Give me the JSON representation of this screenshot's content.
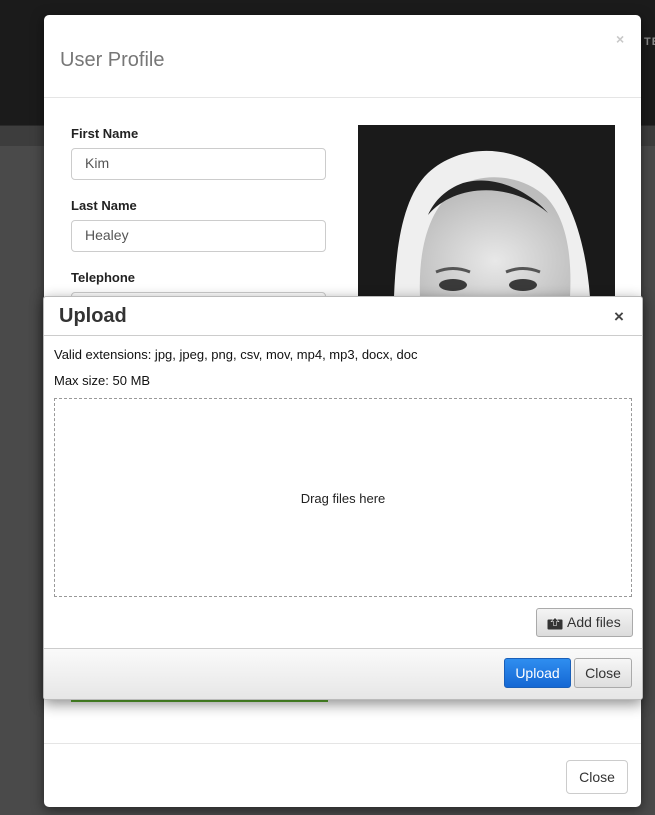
{
  "background": {
    "peek_text": "TE"
  },
  "profile": {
    "title": "User Profile",
    "close_icon": "×",
    "fields": {
      "first_name": {
        "label": "First Name",
        "value": "Kim"
      },
      "last_name": {
        "label": "Last Name",
        "value": "Healey"
      },
      "telephone": {
        "label": "Telephone",
        "value": ""
      }
    },
    "footer_close_label": "Close"
  },
  "upload": {
    "title": "Upload",
    "close_icon": "×",
    "valid_extensions": "Valid extensions: jpg, jpeg, png, csv, mov, mp4, mp3, docx, doc",
    "max_size": "Max size: 50 MB",
    "dropzone_text": "Drag files here",
    "add_files_label": "Add files",
    "add_files_icon": "upload-box-icon",
    "upload_label": "Upload",
    "close_label": "Close"
  },
  "colors": {
    "upload_button": "#1f7ae6",
    "progress_bar": "#5bab2d"
  }
}
